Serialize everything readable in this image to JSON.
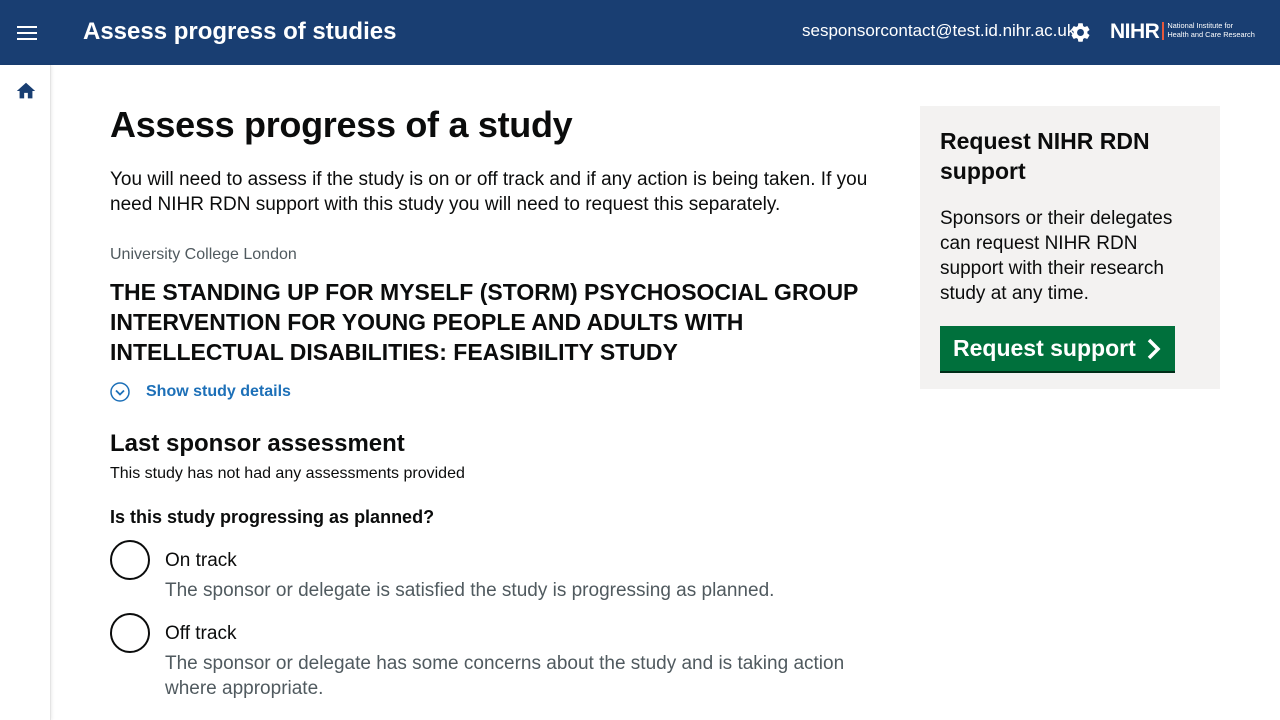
{
  "header": {
    "app_title": "Assess progress of studies",
    "user_email": "sesponsorcontact@test.id.nihr.ac.uk",
    "logo_main": "NIHR",
    "logo_sub_line1": "National Institute for",
    "logo_sub_line2": "Health and Care Research",
    "background_color": "#193e72"
  },
  "sidenav": {
    "home_icon": "home-icon"
  },
  "main": {
    "page_title": "Assess progress of a study",
    "intro": "You will need to assess if the study is on or off track and if any action is being taken. If you need NIHR RDN support with this study you will need to request this separately.",
    "organisation": "University College London",
    "study_title": "THE STANDING UP FOR MYSELF (STORM) PSYCHOSOCIAL GROUP INTERVENTION FOR YOUNG PEOPLE AND ADULTS WITH INTELLECTUAL DISABILITIES: FEASIBILITY STUDY",
    "show_details_label": "Show study details",
    "last_assessment_heading": "Last sponsor assessment",
    "last_assessment_text": "This study has not had any assessments provided",
    "question": "Is this study progressing as planned?",
    "options": [
      {
        "label": "On track",
        "hint": "The sponsor or delegate is satisfied the study is progressing as planned."
      },
      {
        "label": "Off track",
        "hint": "The sponsor or delegate has some concerns about the study and is taking action where appropriate."
      }
    ]
  },
  "panel": {
    "title": "Request NIHR RDN support",
    "text": "Sponsors or their delegates can request NIHR RDN support with their research study at any time.",
    "button_label": "Request support",
    "button_color": "#00703c"
  }
}
